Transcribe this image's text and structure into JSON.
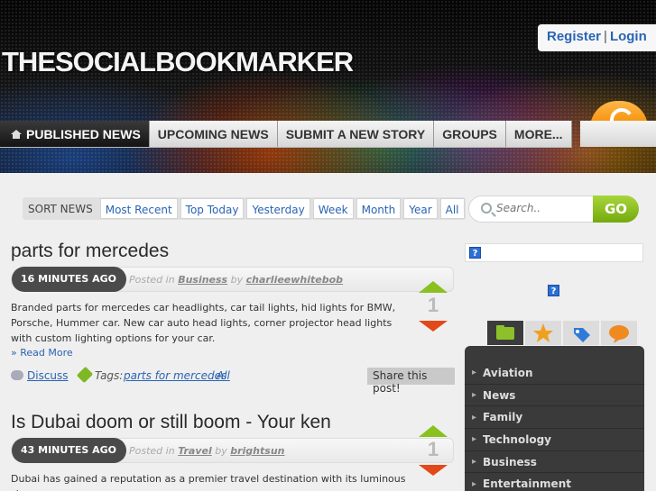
{
  "header": {
    "logo": "THESOCIALBOOKMARKER",
    "register": "Register",
    "separator": "|",
    "login": "Login"
  },
  "nav": {
    "items": [
      {
        "label": "PUBLISHED NEWS",
        "active": true
      },
      {
        "label": "UPCOMING NEWS",
        "active": false
      },
      {
        "label": "SUBMIT A NEW STORY",
        "active": false
      },
      {
        "label": "GROUPS",
        "active": false
      },
      {
        "label": "MORE...",
        "active": false
      }
    ]
  },
  "sort": {
    "label": "SORT NEWS",
    "options": [
      "Most Recent",
      "Top Today",
      "Yesterday",
      "Week",
      "Month",
      "Year",
      "All"
    ]
  },
  "search": {
    "placeholder": "Search..",
    "button": "GO"
  },
  "posts": [
    {
      "title": "parts for mercedes",
      "time": "16 MINUTES AGO",
      "posted_in": "Posted in",
      "category": "Business",
      "by": "by",
      "author": "charlieewhitebob",
      "votes": "1",
      "body": "Branded parts for mercedes car headlights, car tail lights, hid lights for BMW, Porsche, Hummer car. New car auto head lights, corner projector head lights with custom lighting options for your car.",
      "read_more": "» Read More",
      "discuss": "Discuss",
      "tags_label": "Tags:",
      "tags": [
        "parts for mercedes",
        "All"
      ],
      "share": "Share this post!"
    },
    {
      "title": "Is Dubai doom or still boom - Your ken",
      "time": "43 MINUTES AGO",
      "posted_in": "Posted in",
      "category": "Travel",
      "by": "by",
      "author": "brightsun",
      "votes": "1",
      "body": "Dubai has gained a reputation as a premier travel destination with its luminous shores,"
    }
  ],
  "sidebar": {
    "help": "?",
    "categories": [
      "Aviation",
      "News",
      "Family",
      "Technology",
      "Business",
      "Entertainment"
    ],
    "tab_icons": [
      "folder-icon",
      "star-icon",
      "tag-icon",
      "comment-icon"
    ]
  },
  "colors": {
    "accent": "#2a64b4",
    "vote_up": "#8ac020",
    "vote_down": "#e2481a",
    "go_button": "#8cc12a",
    "sidebar_panel": "#3a3a3a"
  }
}
